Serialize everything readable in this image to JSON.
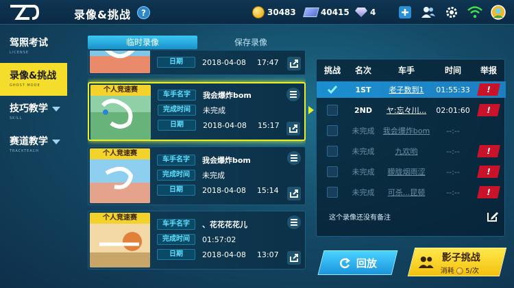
{
  "header": {
    "title": "录像&挑战",
    "help": "?",
    "resources": [
      {
        "icon": "coin-icon",
        "value": "30483"
      },
      {
        "icon": "ticket-icon",
        "value": "40415"
      },
      {
        "icon": "gem-icon",
        "value": "4"
      }
    ]
  },
  "sidebar": {
    "items": [
      {
        "label": "驾照考试",
        "sub": "LICENSE"
      },
      {
        "label": "录像&挑战",
        "sub": "GHOST MODE"
      },
      {
        "label": "技巧教学",
        "sub": "SKILL"
      },
      {
        "label": "赛道教学",
        "sub": "TRACKTEACH"
      }
    ]
  },
  "tabs": [
    "临时录像",
    "保存录像"
  ],
  "records": [
    {
      "tag": "",
      "name_key": "",
      "name": "",
      "time_key": "",
      "time": "",
      "date_key": "日期",
      "date": "2018-04-08",
      "clock": "17:47"
    },
    {
      "tag": "个人竞速赛",
      "name_key": "车手名字",
      "name": "我会爆炸bom",
      "time_key": "完成时间",
      "time": "未完成",
      "date_key": "日期",
      "date": "2018-04-08",
      "clock": "15:17"
    },
    {
      "tag": "个人竞速赛",
      "name_key": "车手名字",
      "name": "我会爆炸bom",
      "time_key": "完成时间",
      "time": "未完成",
      "date_key": "日期",
      "date": "2018-04-08",
      "clock": "15:14"
    },
    {
      "tag": "个人竞速赛",
      "name_key": "车手名字",
      "name": "、花花花花儿",
      "time_key": "完成时间",
      "time": "01:57:02",
      "date_key": "日期",
      "date": "2018-04-08",
      "clock": "13:07"
    }
  ],
  "ranking": {
    "headers": [
      "挑战",
      "名次",
      "车手",
      "时间",
      "举报"
    ],
    "rows": [
      {
        "rank": "1ST",
        "driver": "老子数到1",
        "time": "01:55:33"
      },
      {
        "rank": "2ND",
        "driver": "ヤ:忘々川...",
        "time": "02:01:60"
      },
      {
        "rank": "未完成",
        "driver": "我会爆炸bom",
        "time": "--:--"
      },
      {
        "rank": "未完成",
        "driver": "九欢哟",
        "time": "--:--"
      },
      {
        "rank": "未完成",
        "driver": "朦胧烟雨涩",
        "time": "--:--"
      },
      {
        "rank": "未完成",
        "driver": "可杀...昆顿",
        "time": "--:--"
      }
    ],
    "report_mark": "!",
    "note": "这个录像还没有备注"
  },
  "actions": {
    "replay": "回放",
    "shadow_title": "影子挑战",
    "shadow_cost_prefix": "消耗",
    "shadow_cost": "5/次"
  }
}
